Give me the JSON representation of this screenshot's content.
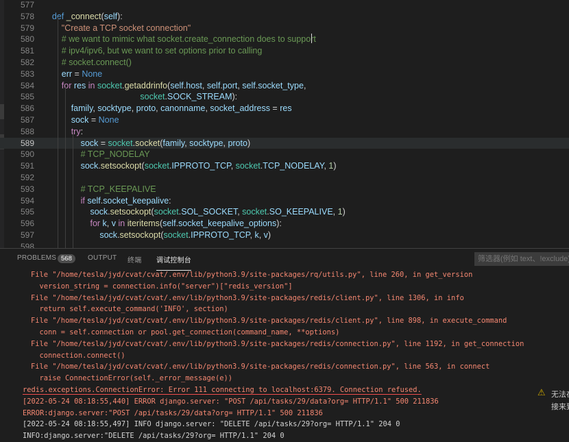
{
  "editor": {
    "lines": [
      {
        "num": "577",
        "html": ""
      },
      {
        "num": "578",
        "html": "    <span class='kw'>def</span> <span class='fn'>_connect</span>(<span class='var'>self</span>):"
      },
      {
        "num": "579",
        "html": "        <span class='str'>\"Create a TCP socket connection\"</span>"
      },
      {
        "num": "580",
        "html": "        <span class='cm'># we want to mimic what socket.create_connection does to support</span>"
      },
      {
        "num": "581",
        "html": "        <span class='cm'># ipv4/ipv6, but we want to set options prior to calling</span>"
      },
      {
        "num": "582",
        "html": "        <span class='cm'># socket.connect()</span>"
      },
      {
        "num": "583",
        "html": "        <span class='var'>err</span> = <span class='kw'>None</span>"
      },
      {
        "num": "584",
        "html": "        <span class='ctl'>for</span> <span class='var'>res</span> <span class='ctl'>in</span> <span class='mod'>socket</span>.<span class='fn'>getaddrinfo</span>(<span class='var'>self</span>.<span class='var'>host</span>, <span class='var'>self</span>.<span class='var'>port</span>, <span class='var'>self</span>.<span class='var'>socket_type</span>,"
      },
      {
        "num": "585",
        "html": "                                         <span class='mod'>socket</span>.<span class='var'>SOCK_STREAM</span>):"
      },
      {
        "num": "586",
        "html": "            <span class='var'>family</span>, <span class='var'>socktype</span>, <span class='var'>proto</span>, <span class='var'>canonname</span>, <span class='var'>socket_address</span> = <span class='var'>res</span>"
      },
      {
        "num": "587",
        "html": "            <span class='var'>sock</span> = <span class='kw'>None</span>"
      },
      {
        "num": "588",
        "html": "            <span class='ctl'>try</span>:"
      },
      {
        "num": "589",
        "html": "                <span class='var'>sock</span> = <span class='mod'>socket</span>.<span class='fn'>socket</span>(<span class='var'>family</span>, <span class='var'>socktype</span>, <span class='var'>proto</span>)"
      },
      {
        "num": "590",
        "html": "                <span class='cm'># TCP_NODELAY</span>"
      },
      {
        "num": "591",
        "html": "                <span class='var'>sock</span>.<span class='fn'>setsockopt</span>(<span class='mod'>socket</span>.<span class='var'>IPPROTO_TCP</span>, <span class='mod'>socket</span>.<span class='var'>TCP_NODELAY</span>, <span class='num'>1</span>)"
      },
      {
        "num": "592",
        "html": ""
      },
      {
        "num": "593",
        "html": "                <span class='cm'># TCP_KEEPALIVE</span>"
      },
      {
        "num": "594",
        "html": "                <span class='ctl'>if</span> <span class='var'>self</span>.<span class='var'>socket_keepalive</span>:"
      },
      {
        "num": "595",
        "html": "                    <span class='var'>sock</span>.<span class='fn'>setsockopt</span>(<span class='mod'>socket</span>.<span class='var'>SOL_SOCKET</span>, <span class='mod'>socket</span>.<span class='var'>SO_KEEPALIVE</span>, <span class='num'>1</span>)"
      },
      {
        "num": "596",
        "html": "                    <span class='ctl'>for</span> <span class='var'>k</span>, <span class='var'>v</span> <span class='ctl'>in</span> <span class='fn'>iteritems</span>(<span class='var'>self</span>.<span class='var'>socket_keepalive_options</span>):"
      },
      {
        "num": "597",
        "html": "                        <span class='var'>sock</span>.<span class='fn'>setsockopt</span>(<span class='mod'>socket</span>.<span class='var'>IPPROTO_TCP</span>, <span class='var'>k</span>, <span class='var'>v</span>)"
      },
      {
        "num": "598",
        "html": ""
      }
    ],
    "current_line": "589"
  },
  "panel": {
    "tabs": [
      {
        "label": "PROBLEMS",
        "active": false
      },
      {
        "label": "OUTPUT",
        "active": false
      },
      {
        "label": "终端",
        "active": false
      },
      {
        "label": "调试控制台",
        "active": true
      }
    ],
    "problems_count": "568",
    "filter_placeholder": "筛选器(例如 text、!exclude)",
    "terminal_lines": [
      {
        "text": "File \"/home/tesla/jyd/cvat/cvat/.env/lib/python3.9/site-packages/rq/utils.py\", line 260, in get_version",
        "type": "trace"
      },
      {
        "text": "  version_string = connection.info(\"server\")[\"redis_version\"]",
        "type": "trace"
      },
      {
        "text": "File \"/home/tesla/jyd/cvat/cvat/.env/lib/python3.9/site-packages/redis/client.py\", line 1306, in info",
        "type": "trace"
      },
      {
        "text": "  return self.execute_command('INFO', section)",
        "type": "trace"
      },
      {
        "text": "File \"/home/tesla/jyd/cvat/cvat/.env/lib/python3.9/site-packages/redis/client.py\", line 898, in execute_command",
        "type": "trace"
      },
      {
        "text": "  conn = self.connection or pool.get_connection(command_name, **options)",
        "type": "trace"
      },
      {
        "text": "File \"/home/tesla/jyd/cvat/cvat/.env/lib/python3.9/site-packages/redis/connection.py\", line 1192, in get_connection",
        "type": "trace"
      },
      {
        "text": "  connection.connect()",
        "type": "trace"
      },
      {
        "text": "File \"/home/tesla/jyd/cvat/cvat/.env/lib/python3.9/site-packages/redis/connection.py\", line 563, in connect",
        "type": "trace"
      },
      {
        "text": "  raise ConnectionError(self._error_message(e))",
        "type": "trace"
      },
      {
        "text": "redis.exceptions.ConnectionError: Error 111 connecting to localhost:6379. Connection refused.",
        "type": "err"
      },
      {
        "text": "[2022-05-24 08:18:55,440] ERROR django.server: \"POST /api/tasks/29/data?org= HTTP/1.1\" 500 211836",
        "type": "errlog"
      },
      {
        "text": "ERROR:django.server:\"POST /api/tasks/29/data?org= HTTP/1.1\" 500 211836",
        "type": "errlog"
      },
      {
        "text": "[2022-05-24 08:18:55,497] INFO django.server: \"DELETE /api/tasks/29?org= HTTP/1.1\" 204 0",
        "type": "info"
      },
      {
        "text": "INFO:django.server:\"DELETE /api/tasks/29?org= HTTP/1.1\" 204 0",
        "type": "info"
      }
    ]
  },
  "notification": {
    "icon": "warning-icon",
    "line1": "无法在",
    "line2": "接来到"
  }
}
